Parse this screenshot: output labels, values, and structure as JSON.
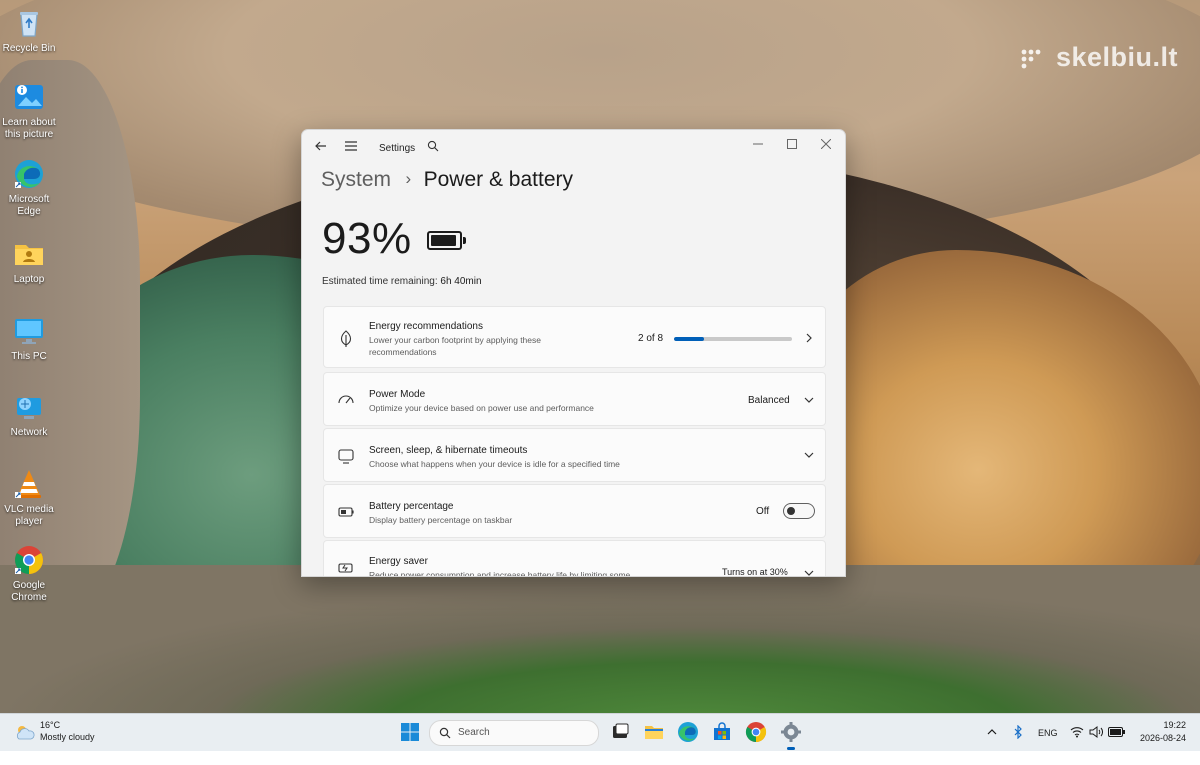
{
  "watermark": "skelbiu.lt",
  "desktop_icons": [
    {
      "label": "Recycle Bin",
      "icon": "recycle-bin-icon"
    },
    {
      "label": "Learn about this picture",
      "icon": "learn-about-picture-icon"
    },
    {
      "label": "Microsoft Edge",
      "icon": "edge-icon"
    },
    {
      "label": "Laptop",
      "icon": "user-folder-icon"
    },
    {
      "label": "This PC",
      "icon": "monitor-icon"
    },
    {
      "label": "Network",
      "icon": "network-icon"
    },
    {
      "label": "VLC media player",
      "icon": "vlc-icon"
    },
    {
      "label": "Google Chrome",
      "icon": "chrome-icon"
    }
  ],
  "window": {
    "title": "Settings",
    "breadcrumb_parent": "System",
    "breadcrumb_separator": "›",
    "page_title": "Power & battery",
    "battery_percent": "93%",
    "battery_level": 0.93,
    "estimated_label": "Estimated time remaining:",
    "estimated_value": "6h 40min",
    "cards": {
      "energy_rec": {
        "title": "Energy recommendations",
        "desc": "Lower your carbon footprint by applying these recommendations",
        "count": "2 of 8",
        "progress": 0.25
      },
      "power_mode": {
        "title": "Power Mode",
        "desc": "Optimize your device based on power use and performance",
        "value": "Balanced"
      },
      "timeouts": {
        "title": "Screen, sleep, & hibernate timeouts",
        "desc": "Choose what happens when your device is idle for a specified time"
      },
      "battery_pct": {
        "title": "Battery percentage",
        "desc": "Display battery percentage on taskbar",
        "state": "Off"
      },
      "energy_saver": {
        "title": "Energy saver",
        "desc": "Reduce power consumption and increase battery life by limiting some",
        "value": "Turns on at 30%"
      }
    }
  },
  "taskbar": {
    "weather_temp": "16°C",
    "weather_cond": "Mostly cloudy",
    "search_placeholder": "Search",
    "language": "ENG",
    "time": "19:22",
    "date": "2026-08-24"
  },
  "colors": {
    "accent": "#005fb8",
    "window_bg": "#f3f3f3",
    "card_bg": "#fbfbfb",
    "taskbar_bg": "#e9eef2"
  }
}
